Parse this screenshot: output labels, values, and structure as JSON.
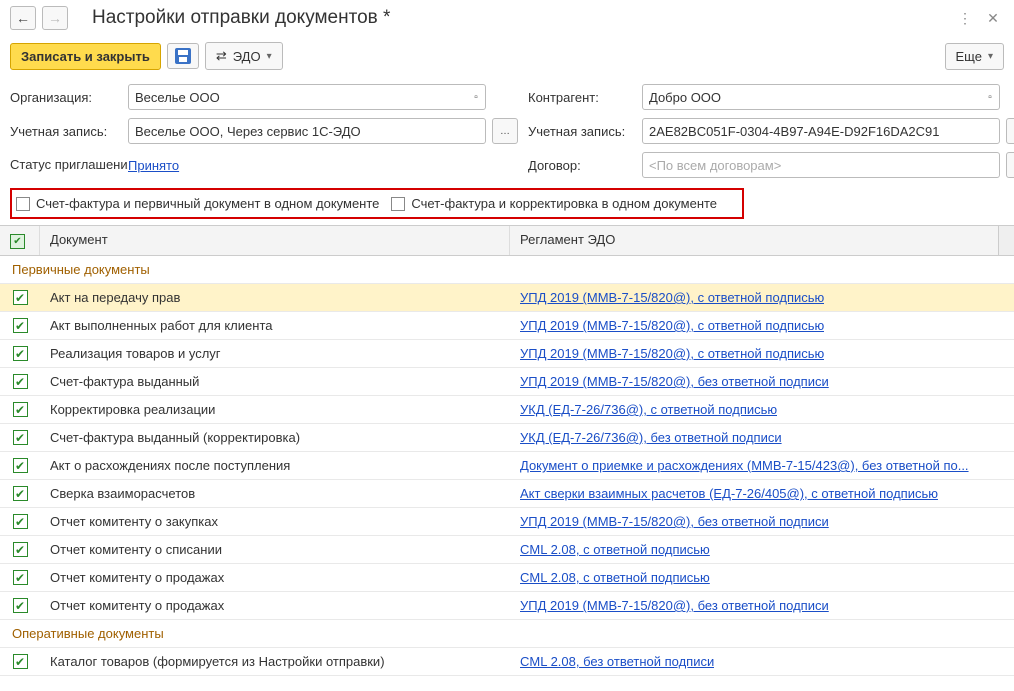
{
  "title": "Настройки отправки документов *",
  "toolbar": {
    "save_close": "Записать и закрыть",
    "edo": "ЭДО",
    "more": "Еще"
  },
  "left": {
    "org_label": "Организация:",
    "org_value": "Веселье ООО",
    "acct_label": "Учетная запись:",
    "acct_value": "Веселье ООО, Через сервис 1С-ЭДО",
    "status_label": "Статус приглашения:",
    "status_value": "Принято"
  },
  "right": {
    "counter_label": "Контрагент:",
    "counter_value": "Добро ООО",
    "acct_label": "Учетная запись:",
    "acct_value": "2AE82BC051F-0304-4B97-A94E-D92F16DA2C91",
    "contract_label": "Договор:",
    "contract_placeholder": "<По всем договорам>"
  },
  "checks": {
    "c1": "Счет-фактура и первичный документ в одном документе",
    "c2": "Счет-фактура и корректировка в одном документе"
  },
  "table": {
    "col_doc": "Документ",
    "col_reg": "Регламент ЭДО",
    "group1": "Первичные документы",
    "group2": "Оперативные документы",
    "rows": [
      {
        "doc": "Акт на передачу прав",
        "reg": "УПД 2019 (ММВ-7-15/820@), с ответной подписью",
        "selected": true
      },
      {
        "doc": "Акт выполненных работ для клиента",
        "reg": "УПД 2019 (ММВ-7-15/820@), с ответной подписью"
      },
      {
        "doc": "Реализация товаров и услуг",
        "reg": "УПД 2019 (ММВ-7-15/820@), с ответной подписью"
      },
      {
        "doc": "Счет-фактура выданный",
        "reg": "УПД 2019 (ММВ-7-15/820@), без ответной подписи"
      },
      {
        "doc": "Корректировка реализации",
        "reg": "УКД (ЕД-7-26/736@), с ответной подписью"
      },
      {
        "doc": "Счет-фактура выданный (корректировка)",
        "reg": "УКД (ЕД-7-26/736@), без ответной подписи"
      },
      {
        "doc": "Акт о расхождениях после поступления",
        "reg": "Документ о приемке и расхождениях (ММВ-7-15/423@), без ответной по..."
      },
      {
        "doc": "Сверка взаиморасчетов",
        "reg": "Акт сверки взаимных расчетов (ЕД-7-26/405@), с ответной подписью"
      },
      {
        "doc": "Отчет комитенту о закупках",
        "reg": "УПД 2019 (ММВ-7-15/820@), без ответной подписи"
      },
      {
        "doc": "Отчет комитенту о списании",
        "reg": "CML 2.08, с ответной подписью"
      },
      {
        "doc": "Отчет комитенту о продажах",
        "reg": "CML 2.08, с ответной подписью"
      },
      {
        "doc": "Отчет комитенту о продажах",
        "reg": "УПД 2019 (ММВ-7-15/820@), без ответной подписи"
      }
    ],
    "rows2": [
      {
        "doc": "Каталог товаров (формируется из Настройки отправки)",
        "reg": "CML 2.08, без ответной подписи"
      }
    ]
  }
}
